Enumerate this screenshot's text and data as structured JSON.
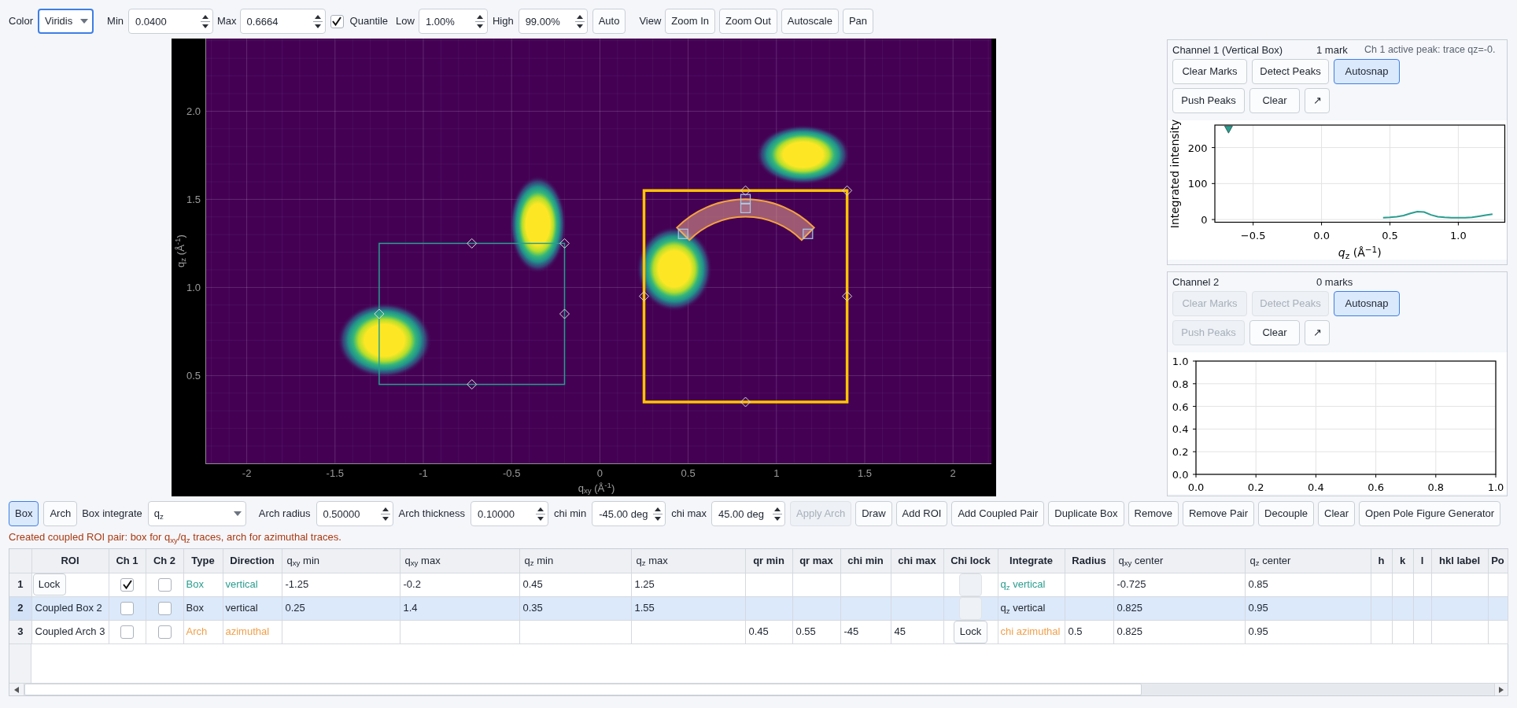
{
  "toolbar": {
    "color": {
      "label": "Color",
      "value": "Viridis",
      "focused": true
    },
    "min": {
      "label": "Min",
      "value": "0.0400"
    },
    "max": {
      "label": "Max",
      "value": "0.6664"
    },
    "quantile": {
      "label": "Quantile",
      "checked": true
    },
    "low": {
      "label": "Low",
      "value": "1.00%"
    },
    "high": {
      "label": "High",
      "value": "99.00%"
    },
    "auto_button": "Auto",
    "view": {
      "label": "View",
      "buttons": [
        "Zoom In",
        "Zoom Out",
        "Autoscale",
        "Pan"
      ]
    }
  },
  "image_plot": {
    "xlabel": "q$_{xy}$ (Å$^{-1}$)",
    "ylabel": "q$_{z}$ (Å$^{-1}$)",
    "xticks": [
      "-2",
      "-1.5",
      "-1",
      "-0.5",
      "0",
      "0.5",
      "1",
      "1.5",
      "2"
    ],
    "yticks": [
      "2.0",
      "1.5",
      "1.0",
      "0.5"
    ]
  },
  "channels": [
    {
      "title": "Channel 1 (Vertical Box)",
      "marks": "1 mark",
      "status": "Ch 1 active peak: trace qz=-0.",
      "buttons": [
        {
          "label": "Clear Marks",
          "disabled": false,
          "on": false
        },
        {
          "label": "Detect Peaks",
          "disabled": false,
          "on": false
        },
        {
          "label": "Autosnap",
          "disabled": false,
          "on": true
        },
        {
          "label": "Push Peaks",
          "disabled": false,
          "on": false
        },
        {
          "label": "Clear",
          "disabled": false,
          "on": false
        },
        {
          "label": "↗",
          "disabled": false,
          "on": false
        }
      ],
      "chart_data": {
        "type": "line",
        "xlabel": "*q*$_{z}$ (Å$^{−1}$)",
        "ylabel": "Integrated intensity",
        "grid": true,
        "xlim": [
          -0.78,
          1.34
        ],
        "ylim": [
          -7.5,
          262.5
        ],
        "xticks": [
          {
            "value": -0.5,
            "label": "−0.5"
          },
          {
            "value": 0,
            "label": "0.0"
          },
          {
            "value": 0.5,
            "label": "0.5"
          },
          {
            "value": 1,
            "label": "1.0"
          }
        ],
        "yticks": [
          {
            "value": 0,
            "label": "0"
          },
          {
            "value": 100,
            "label": "100"
          },
          {
            "value": 200,
            "label": "200"
          }
        ],
        "x": [
          -0.68,
          0.45,
          0.5,
          0.55,
          0.6,
          0.65,
          0.7,
          0.75,
          0.8,
          0.85,
          0.9,
          0.95,
          1.0,
          1.05,
          1.1,
          1.15,
          1.2,
          1.25
        ],
        "series": [
          {
            "color": "#2a9d8f",
            "values": [
              null,
              5,
              6,
              8,
              11,
              17,
              22,
              21,
              13,
              8,
              6,
              5,
              5,
              5,
              6,
              9,
              12,
              15
            ]
          },
          {
            "color": "#2a9d8f",
            "marker": "v",
            "values": [
              250,
              null,
              null,
              null,
              null,
              null,
              null,
              null,
              null,
              null,
              null,
              null,
              null,
              null,
              null,
              null,
              null,
              null
            ]
          }
        ]
      }
    },
    {
      "title": "Channel 2",
      "marks": "0 marks",
      "buttons": [
        {
          "label": "Clear Marks",
          "disabled": true,
          "on": false
        },
        {
          "label": "Detect Peaks",
          "disabled": true,
          "on": false
        },
        {
          "label": "Autosnap",
          "disabled": false,
          "on": true
        },
        {
          "label": "Push Peaks",
          "disabled": true,
          "on": false
        },
        {
          "label": "Clear",
          "disabled": false,
          "on": false
        },
        {
          "label": "↗",
          "disabled": false,
          "on": false
        }
      ],
      "chart_data": {
        "type": "line",
        "grid": true,
        "xlim": [
          0,
          1
        ],
        "ylim": [
          0,
          1
        ],
        "xticks": [
          {
            "value": 0,
            "label": "0.0"
          },
          {
            "value": 0.2,
            "label": "0.2"
          },
          {
            "value": 0.4,
            "label": "0.4"
          },
          {
            "value": 0.6,
            "label": "0.6"
          },
          {
            "value": 0.8,
            "label": "0.8"
          },
          {
            "value": 1,
            "label": "1.0"
          }
        ],
        "yticks": [
          {
            "value": 0,
            "label": "0.0"
          },
          {
            "value": 0.2,
            "label": "0.2"
          },
          {
            "value": 0.4,
            "label": "0.4"
          },
          {
            "value": 0.6,
            "label": "0.6"
          },
          {
            "value": 0.8,
            "label": "0.8"
          },
          {
            "value": 1,
            "label": "1.0"
          }
        ]
      }
    }
  ],
  "roi_toolbar": {
    "modes": [
      {
        "label": "Box",
        "selected": true
      },
      {
        "label": "Arch",
        "selected": false
      }
    ],
    "box_integrate": {
      "label": "Box integrate",
      "value": "q$_{z}$"
    },
    "arch_radius": {
      "label": "Arch radius",
      "value": "0.50000"
    },
    "arch_thickness": {
      "label": "Arch thickness",
      "value": "0.10000"
    },
    "chi_min": {
      "label": "chi min",
      "value": "-45.00 deg"
    },
    "chi_max": {
      "label": "chi max",
      "value": "45.00 deg"
    },
    "buttons": [
      {
        "label": "Apply Arch",
        "disabled": true
      },
      {
        "label": "Draw",
        "disabled": false
      },
      {
        "label": "Add ROI",
        "disabled": false
      },
      {
        "label": "Add Coupled Pair",
        "disabled": false
      },
      {
        "label": "Duplicate Box",
        "disabled": false
      },
      {
        "label": "Remove",
        "disabled": false
      },
      {
        "label": "Remove Pair",
        "disabled": false
      },
      {
        "label": "Decouple",
        "disabled": false
      },
      {
        "label": "Clear",
        "disabled": false
      },
      {
        "label": "Open Pole Figure Generator",
        "disabled": false
      }
    ]
  },
  "message": "Created coupled ROI pair: box for q$_{xy}$/q$_{z}$ traces, arch for azimuthal traces.",
  "table": {
    "columns": [
      {
        "label": "ROI",
        "kind": "text"
      },
      {
        "label": "Ch 1",
        "kind": "text"
      },
      {
        "label": "Ch 2",
        "kind": "text"
      },
      {
        "label": "Type",
        "kind": "text"
      },
      {
        "label": "Direction",
        "kind": "text"
      },
      {
        "label": "q$_{xy}$ min",
        "kind": "math"
      },
      {
        "label": "q$_{xy}$ max",
        "kind": "math"
      },
      {
        "label": "q$_{z}$ min",
        "kind": "math"
      },
      {
        "label": "q$_{z}$ max",
        "kind": "math"
      },
      {
        "label": "qr min",
        "kind": "text"
      },
      {
        "label": "qr max",
        "kind": "text"
      },
      {
        "label": "chi min",
        "kind": "text"
      },
      {
        "label": "chi max",
        "kind": "text"
      },
      {
        "label": "Chi lock",
        "kind": "text"
      },
      {
        "label": "Integrate",
        "kind": "text"
      },
      {
        "label": "Radius",
        "kind": "text"
      },
      {
        "label": "q$_{xy}$ center",
        "kind": "math"
      },
      {
        "label": "q$_{z}$ center",
        "kind": "math"
      },
      {
        "label": "h",
        "kind": "text"
      },
      {
        "label": "k",
        "kind": "text"
      },
      {
        "label": "l",
        "kind": "text"
      },
      {
        "label": "hkl label",
        "kind": "text"
      },
      {
        "label": "Po",
        "kind": "text"
      }
    ],
    "rows": [
      {
        "number": "1",
        "selected": false,
        "color": "#2a9d8f",
        "roi": {
          "kind": "button",
          "label": "Lock"
        },
        "ch1": {
          "checked": true
        },
        "ch2": {
          "checked": false
        },
        "type": "Box",
        "direction": "vertical",
        "qxy_min": "-1.25",
        "qxy_max": "-0.2",
        "qz_min": "0.45",
        "qz_max": "1.25",
        "chi_lock": {
          "kind": "blank"
        },
        "integrate": "q$_{z}$ vertical",
        "qxy_center": "-0.725",
        "qz_center": "0.85"
      },
      {
        "number": "2",
        "selected": true,
        "color": "#1f2328",
        "roi": {
          "kind": "text",
          "label": "Coupled Box 2"
        },
        "ch1": {
          "checked": false
        },
        "ch2": {
          "checked": false
        },
        "type": "Box",
        "direction": "vertical",
        "qxy_min": "0.25",
        "qxy_max": "1.4",
        "qz_min": "0.35",
        "qz_max": "1.55",
        "chi_lock": {
          "kind": "blank"
        },
        "integrate": "q$_{z}$ vertical",
        "qxy_center": "0.825",
        "qz_center": "0.95"
      },
      {
        "number": "3",
        "selected": false,
        "color": "#f0a04b",
        "roi": {
          "kind": "text",
          "label": "Coupled Arch 3"
        },
        "ch1": {
          "checked": false
        },
        "ch2": {
          "checked": false
        },
        "type": "Arch",
        "direction": "azimuthal",
        "qr_min": "0.45",
        "qr_max": "0.55",
        "chi_min": "-45",
        "chi_max": "45",
        "chi_lock": {
          "kind": "button",
          "label": "Lock"
        },
        "integrate": "chi azimuthal",
        "radius": "0.5",
        "qxy_center": "0.825",
        "qz_center": "0.95"
      }
    ]
  }
}
